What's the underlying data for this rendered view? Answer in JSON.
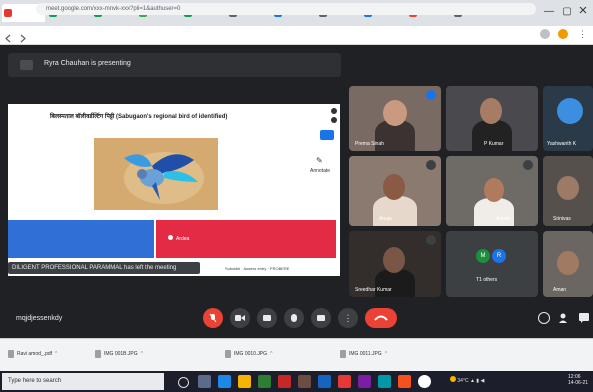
{
  "browser": {
    "url": "meet.google.com/xxx-mnvk-xxx?pli=1&authuser=0",
    "tabs": [
      {
        "label": "",
        "color": "#e53935"
      },
      {
        "label": "",
        "color": "#0f9d58"
      },
      {
        "label": "",
        "color": "#0f9d58"
      },
      {
        "label": "",
        "color": "#34a853"
      },
      {
        "label": "",
        "color": "#0f9d58"
      },
      {
        "label": "",
        "color": "#5f6368"
      },
      {
        "label": "",
        "color": "#1a73e8"
      },
      {
        "label": "",
        "color": "#5f6368"
      },
      {
        "label": "",
        "color": "#1a73e8"
      },
      {
        "label": "",
        "color": "#ea4335"
      },
      {
        "label": "",
        "color": "#5f6368"
      }
    ],
    "new_tab": "+",
    "minimize": "—",
    "maximize": "▢"
  },
  "meet": {
    "presenting_banner": "Ryra Chauhan is presenting",
    "slide": {
      "title": "बिलस्पताल बॉलीवर्डल्टिंग पिट्टी (Sabugaon's regional bird of identified)",
      "annotation": "Annotate",
      "red_label": "Ardea",
      "footer": "Subsiditi · Assess entry · PROBERE"
    },
    "toast": "DILIGENT PROFESSIONAL PARAMMAL has left the meeting",
    "participants": [
      {
        "name": "Prema Sinah"
      },
      {
        "name": "P Kumar"
      },
      {
        "name": "Yashwanth K"
      },
      {
        "name": "Anuja"
      },
      {
        "name": "Aarohi"
      },
      {
        "name": "Srinivas"
      },
      {
        "name": "Sreedhar Kumar"
      },
      {
        "name": "T1 others",
        "initials": [
          "M",
          "R"
        ]
      },
      {
        "name": "Aman"
      }
    ],
    "meeting_code": "mqjdjessenkdy"
  },
  "downloads": [
    {
      "name": "Ravi amod_.pdf"
    },
    {
      "name": "IMG 001B.JPG"
    },
    {
      "name": "IMG 0010.JPG"
    },
    {
      "name": "IMG 0011.JPG"
    }
  ],
  "taskbar": {
    "search_placeholder": "Type here to search",
    "temperature": "34°C",
    "time": "12:06",
    "date": "14-06-21"
  }
}
